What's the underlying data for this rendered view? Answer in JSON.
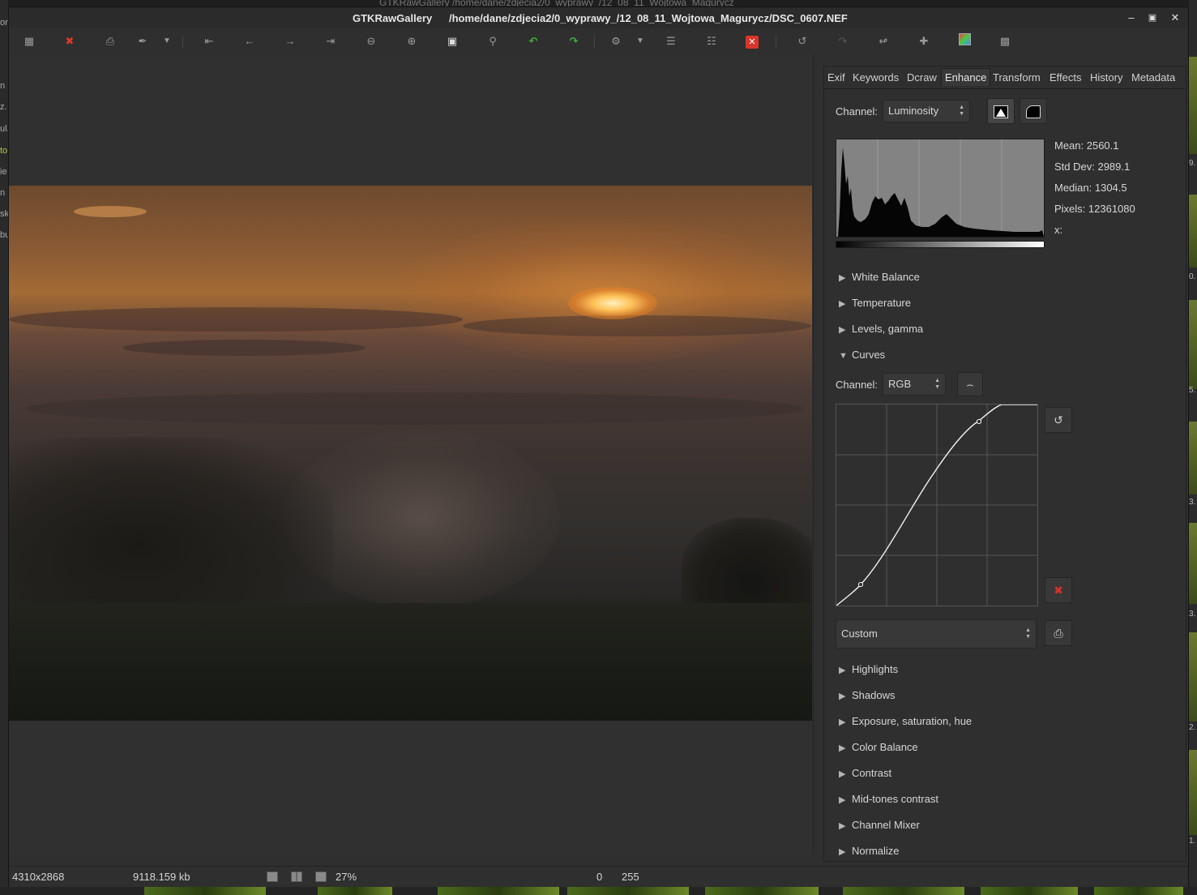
{
  "window": {
    "app_name": "GTKRawGallery",
    "file_path": "/home/dane/zdjecia2/0_wyprawy_/12_08_11_Wojtowa_Magurycz/DSC_0607.NEF",
    "buttons": [
      "minimize",
      "maximize",
      "close"
    ]
  },
  "background_window": {
    "title": "GTKRawGallery     /home/dane/zdjecia2/0_wyprawy_/12_08_11_Wojtowa_Magurycz",
    "left_fragments": [
      "or",
      "n",
      "z.",
      "ul.",
      "to",
      "ie",
      "n",
      "sk",
      "bu"
    ],
    "right_fragments": [
      "9.",
      "0.",
      "5.",
      "3.",
      "3.",
      "2.",
      "1."
    ]
  },
  "toolbar": {
    "icons": [
      "thumbnails-icon",
      "delete-icon",
      "print-icon",
      "brush-icon",
      "dropdown-icon",
      "first-icon",
      "previous-icon",
      "next-icon",
      "last-icon",
      "zoom-out-icon",
      "zoom-in-icon",
      "fit-icon",
      "zoom-100-icon",
      "rotate-left-icon",
      "rotate-right-icon",
      "settings-icon",
      "dropdown-icon",
      "list-icon",
      "properties-icon",
      "close-red-icon",
      "undo-icon",
      "redo-icon",
      "reset-icon",
      "add-icon",
      "color-icon",
      "fullscreen-icon"
    ]
  },
  "tabs": [
    "Exif",
    "Keywords",
    "Dcraw",
    "Enhance",
    "Transform",
    "Effects",
    "History",
    "Metadata"
  ],
  "active_tab": "Enhance",
  "histogram": {
    "channel_label": "Channel:",
    "channel_value": "Luminosity",
    "stats": {
      "mean": "Mean: 2560.1",
      "std_dev": "Std Dev: 2989.1",
      "median": "Median: 1304.5",
      "pixels": "Pixels: 12361080",
      "x": "x:"
    }
  },
  "sections_top": [
    "White Balance",
    "Temperature",
    "Levels, gamma"
  ],
  "curves": {
    "title": "Curves",
    "channel_label": "Channel:",
    "channel_value": "RGB",
    "preset_value": "Custom"
  },
  "sections_bottom": [
    "Highlights",
    "Shadows",
    "Exposure, saturation, hue",
    "Color Balance",
    "Contrast",
    "Mid-tones contrast",
    "Channel Mixer",
    "Normalize"
  ],
  "statusbar": {
    "dimensions": "4310x2868",
    "filesize": "9118.159 kb",
    "zoom": "27%",
    "low": "0",
    "high": "255"
  }
}
